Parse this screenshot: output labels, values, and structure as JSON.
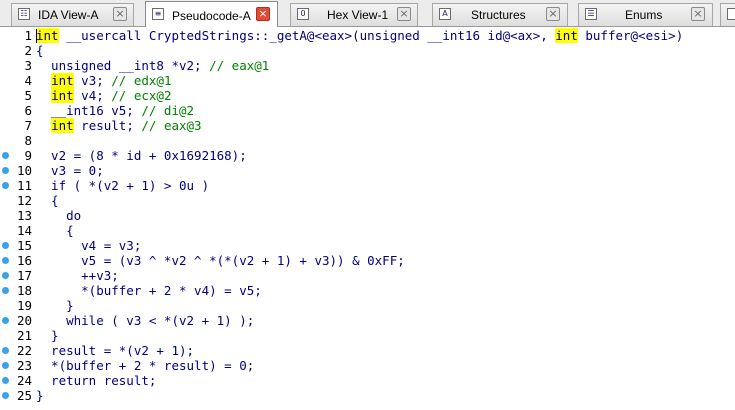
{
  "tabs": [
    {
      "label": "IDA View-A",
      "icon": "graph-view-icon",
      "icon_glyph": "☷",
      "active": false
    },
    {
      "label": "Pseudocode-A",
      "icon": "pseudocode-icon",
      "icon_glyph": "≡",
      "active": true
    },
    {
      "label": "Hex View-1",
      "icon": "hex-view-icon",
      "icon_glyph": "0",
      "active": false
    },
    {
      "label": "Structures",
      "icon": "structures-icon",
      "icon_glyph": "A",
      "active": false
    },
    {
      "label": "Enums",
      "icon": "enums-icon",
      "icon_glyph": "☰",
      "active": false
    }
  ],
  "close_glyph": "×",
  "code": [
    {
      "num": "1",
      "bp": false,
      "text": "int __usercall CryptedStrings::_getA@<eax>(unsigned __int16 id@<ax>, int buffer@<esi>)"
    },
    {
      "num": "2",
      "bp": false,
      "text": "{"
    },
    {
      "num": "3",
      "bp": false,
      "text": "  unsigned __int8 *v2; // eax@1"
    },
    {
      "num": "4",
      "bp": false,
      "text": "  int v3; // edx@1"
    },
    {
      "num": "5",
      "bp": false,
      "text": "  int v4; // ecx@2"
    },
    {
      "num": "6",
      "bp": false,
      "text": "  __int16 v5; // di@2"
    },
    {
      "num": "7",
      "bp": false,
      "text": "  int result; // eax@3"
    },
    {
      "num": "8",
      "bp": false,
      "text": ""
    },
    {
      "num": "9",
      "bp": true,
      "text": "  v2 = (8 * id + 0x1692168);"
    },
    {
      "num": "10",
      "bp": true,
      "text": "  v3 = 0;"
    },
    {
      "num": "11",
      "bp": true,
      "text": "  if ( *(v2 + 1) > 0u )"
    },
    {
      "num": "12",
      "bp": false,
      "text": "  {"
    },
    {
      "num": "13",
      "bp": false,
      "text": "    do"
    },
    {
      "num": "14",
      "bp": false,
      "text": "    {"
    },
    {
      "num": "15",
      "bp": true,
      "text": "      v4 = v3;"
    },
    {
      "num": "16",
      "bp": true,
      "text": "      v5 = (v3 ^ *v2 ^ *(*(v2 + 1) + v3)) & 0xFF;"
    },
    {
      "num": "17",
      "bp": true,
      "text": "      ++v3;"
    },
    {
      "num": "18",
      "bp": true,
      "text": "      *(buffer + 2 * v4) = v5;"
    },
    {
      "num": "19",
      "bp": false,
      "text": "    }"
    },
    {
      "num": "20",
      "bp": true,
      "text": "    while ( v3 < *(v2 + 1) );"
    },
    {
      "num": "21",
      "bp": false,
      "text": "  }"
    },
    {
      "num": "22",
      "bp": true,
      "text": "  result = *(v2 + 1);"
    },
    {
      "num": "23",
      "bp": true,
      "text": "  *(buffer + 2 * result) = 0;"
    },
    {
      "num": "24",
      "bp": true,
      "text": "  return result;"
    },
    {
      "num": "25",
      "bp": true,
      "text": "}"
    }
  ],
  "colors": {
    "keyword_highlight": "#ffff00",
    "code_text": "#000080",
    "comment": "#008000",
    "breakpoint_dot": "#3aa0e8",
    "active_tab_close": "#e24a36"
  }
}
